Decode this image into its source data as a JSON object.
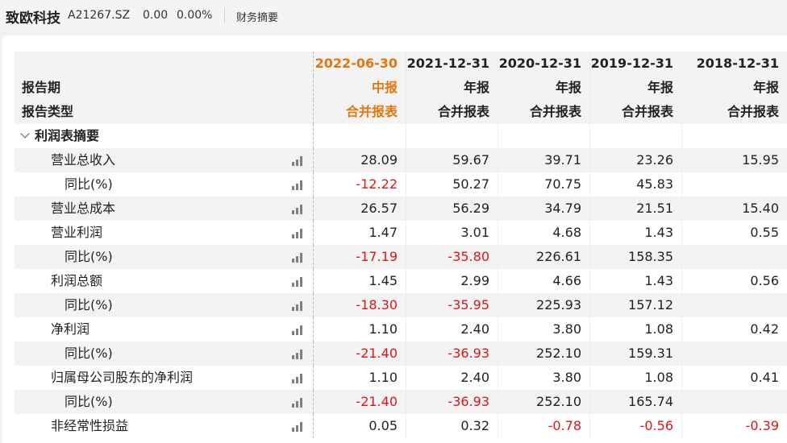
{
  "header": {
    "stock_name": "致欧科技",
    "stock_code": "A21267.SZ",
    "price": "0.00",
    "change_pct": "0.00%",
    "section": "财务摘要"
  },
  "table": {
    "row_labels": {
      "period": "报告期",
      "type": "报告类型"
    },
    "columns": [
      {
        "date": "2022-06-30",
        "period": "中报",
        "type": "合并报表"
      },
      {
        "date": "2021-12-31",
        "period": "年报",
        "type": "合并报表"
      },
      {
        "date": "2020-12-31",
        "period": "年报",
        "type": "合并报表"
      },
      {
        "date": "2019-12-31",
        "period": "年报",
        "type": "合并报表"
      },
      {
        "date": "2018-12-31",
        "period": "年报",
        "type": "合并报表"
      }
    ],
    "section_title": "利润表摘要",
    "rows": [
      {
        "label": "营业总收入",
        "level": 1,
        "values": [
          "28.09",
          "59.67",
          "39.71",
          "23.26",
          "15.95"
        ]
      },
      {
        "label": "同比(%)",
        "level": 2,
        "values": [
          "-12.22",
          "50.27",
          "70.75",
          "45.83",
          ""
        ]
      },
      {
        "label": "营业总成本",
        "level": 1,
        "values": [
          "26.57",
          "56.29",
          "34.79",
          "21.51",
          "15.40"
        ]
      },
      {
        "label": "营业利润",
        "level": 1,
        "values": [
          "1.47",
          "3.01",
          "4.68",
          "1.43",
          "0.55"
        ]
      },
      {
        "label": "同比(%)",
        "level": 2,
        "values": [
          "-17.19",
          "-35.80",
          "226.61",
          "158.35",
          ""
        ]
      },
      {
        "label": "利润总额",
        "level": 1,
        "values": [
          "1.45",
          "2.99",
          "4.66",
          "1.43",
          "0.56"
        ]
      },
      {
        "label": "同比(%)",
        "level": 2,
        "values": [
          "-18.30",
          "-35.95",
          "225.93",
          "157.12",
          ""
        ]
      },
      {
        "label": "净利润",
        "level": 1,
        "values": [
          "1.10",
          "2.40",
          "3.80",
          "1.08",
          "0.42"
        ]
      },
      {
        "label": "同比(%)",
        "level": 2,
        "values": [
          "-21.40",
          "-36.93",
          "252.10",
          "159.31",
          ""
        ]
      },
      {
        "label": "归属母公司股东的净利润",
        "level": 1,
        "values": [
          "1.10",
          "2.40",
          "3.80",
          "1.08",
          "0.41"
        ]
      },
      {
        "label": "同比(%)",
        "level": 2,
        "values": [
          "-21.40",
          "-36.93",
          "252.10",
          "165.74",
          ""
        ]
      },
      {
        "label": "非经常性损益",
        "level": 1,
        "values": [
          "0.05",
          "0.32",
          "-0.78",
          "-0.56",
          "-0.39"
        ]
      }
    ]
  },
  "colors": {
    "highlight": "#e2770f",
    "negative": "#d9161b",
    "shade": "#f3f3f3"
  },
  "icons": {
    "row_chart": "bar-chart-icon",
    "expand": "chevron-down-icon"
  }
}
